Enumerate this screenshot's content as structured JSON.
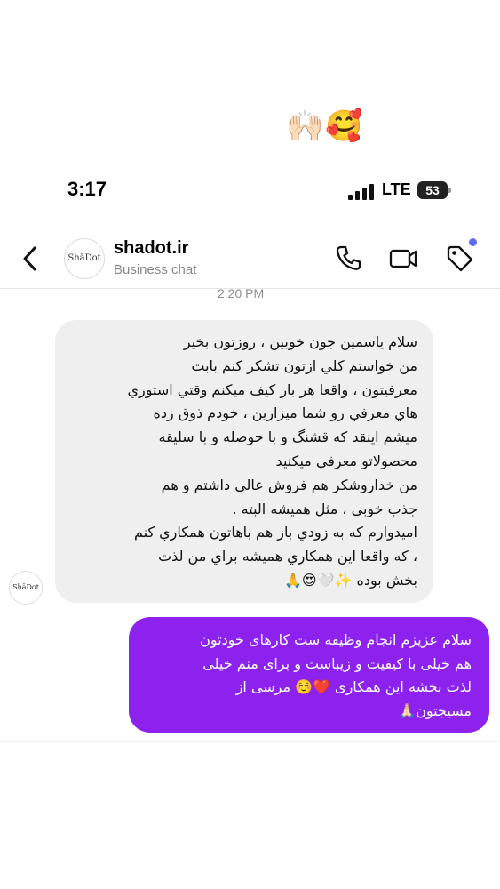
{
  "reaction": {
    "emojis": "🙌🏻🥰"
  },
  "status_bar": {
    "time": "3:17",
    "network": "LTE",
    "battery": "53"
  },
  "header": {
    "avatar_text": "ShāDot",
    "title": "shadot.ir",
    "subtitle": "Business chat",
    "icons": [
      "back-icon",
      "phone-icon",
      "video-icon",
      "tag-icon"
    ],
    "accent_color": "#5f6cf0"
  },
  "timestamp": "2:20 PM",
  "messages": [
    {
      "sender": "shadot.ir",
      "avatar_text": "ShāDot",
      "text": "سلام  یاسمین جون خوبین ، روزتون بخیر\nمن خواستم کلي ازتون تشکر کنم بابت\nمعرفیتون ، واقعا هر بار کیف میکنم وقتي استوري\nهاي معرفي رو شما میزارین ، خودم ذوق زده\nمیشم اینقد که قشنگ و با حوصله و با سلیقه\nمحصولاتو معرفي میکنید\nمن خداروشکر هم فروش عالي داشتم و هم\nجذب خوبي ، مثل همیشه  البته .\nامیدوارم که به زودي باز هم باهاتون همکاري کنم\n، که واقعا این همکاري همیشه براي من لذت\nبخش بوده ✨🤍😍🙏",
      "bubble_color": "#efefef"
    },
    {
      "sender": "me",
      "text": "سلام عزیزم انجام وظیفه ست کارهای خودتون\nهم خیلی با کیفیت و زیباست و برای منم خیلی\nلذت بخشه این همکاری ❤️☺️ مرسی از\nمسیجتون🙏🏻",
      "bubble_color": "#8d22ee"
    }
  ]
}
